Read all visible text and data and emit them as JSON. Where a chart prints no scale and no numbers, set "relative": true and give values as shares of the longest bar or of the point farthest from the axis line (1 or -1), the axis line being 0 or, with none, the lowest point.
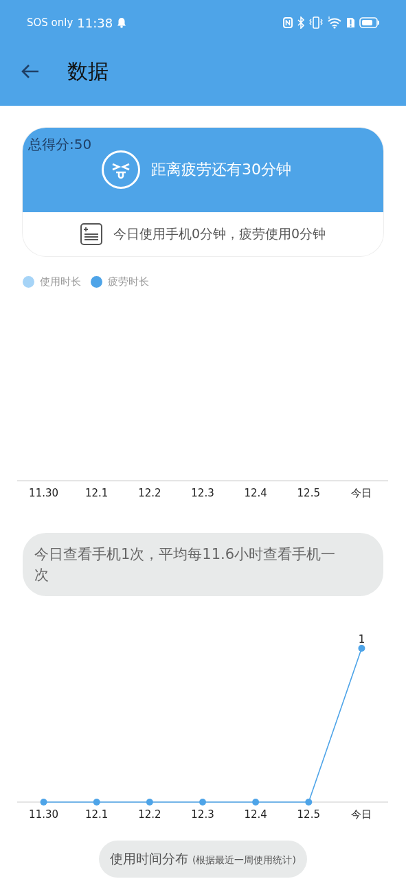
{
  "status_bar": {
    "carrier": "SOS only",
    "time": "11:38"
  },
  "header": {
    "title": "数据"
  },
  "score_card": {
    "score": "总得分:50",
    "message": "距离疲劳还有30分钟",
    "summary": "今日使用手机0分钟，疲劳使用0分钟"
  },
  "usage_chart": {
    "legend": [
      {
        "label": "使用时长",
        "color": "#a6d4f7"
      },
      {
        "label": "疲劳时长",
        "color": "#4ea4e8"
      }
    ],
    "x_labels": [
      "11.30",
      "12.1",
      "12.2",
      "12.3",
      "12.4",
      "12.5",
      "今日"
    ]
  },
  "check_note": "今日查看手机1次，平均每11.6小时查看手机一次",
  "check_chart": {
    "peak_label": "1",
    "chart_data": {
      "type": "line",
      "relative": true,
      "categories": [
        "11.30",
        "12.1",
        "12.2",
        "12.3",
        "12.4",
        "12.5",
        "今日"
      ],
      "series": [
        {
          "color": "#4ea4e8",
          "marker": "circle",
          "values": [
            0,
            0,
            0,
            0,
            0,
            0,
            1
          ]
        }
      ]
    }
  },
  "distribution_pill": {
    "title": "使用时间分布",
    "note": "(根据最近一周使用统计)"
  }
}
